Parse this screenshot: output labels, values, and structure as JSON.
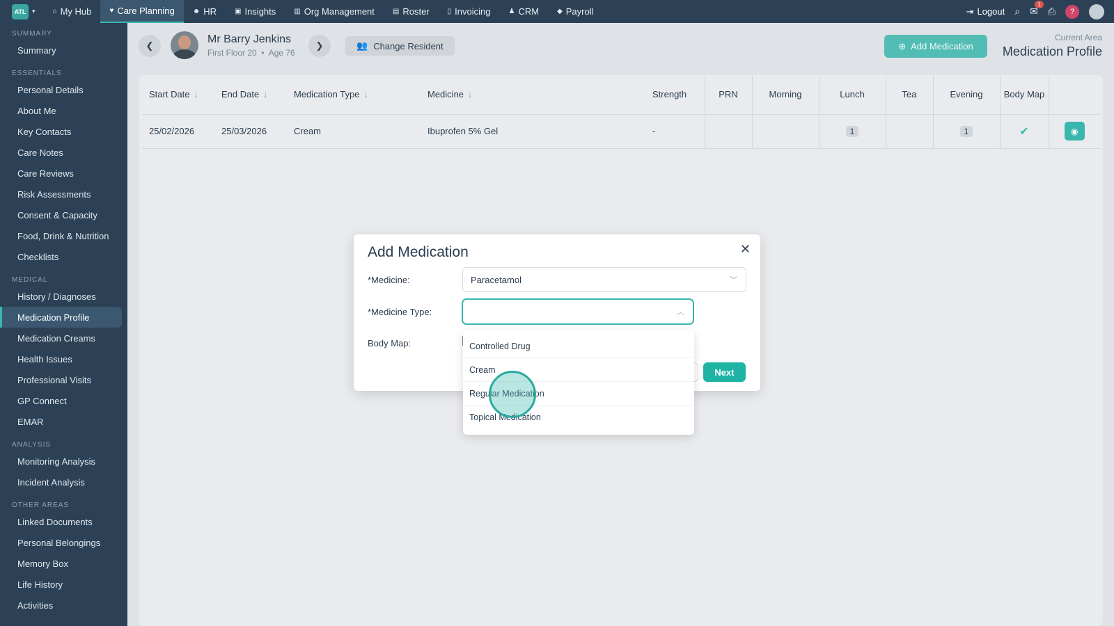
{
  "topnav": {
    "logo": "ATL",
    "items": [
      {
        "icon": "home-icon",
        "label": "My Hub"
      },
      {
        "icon": "heart-icon",
        "label": "Care Planning",
        "active": true
      },
      {
        "icon": "people-icon",
        "label": "HR"
      },
      {
        "icon": "insights-icon",
        "label": "Insights"
      },
      {
        "icon": "building-icon",
        "label": "Org Management"
      },
      {
        "icon": "calendar-icon",
        "label": "Roster"
      },
      {
        "icon": "document-icon",
        "label": "Invoicing"
      },
      {
        "icon": "user-tie-icon",
        "label": "CRM"
      },
      {
        "icon": "tag-icon",
        "label": "Payroll"
      }
    ],
    "logout": "Logout",
    "mail_badge": "1",
    "help": "?"
  },
  "sidebar": {
    "sections": [
      {
        "title": "SUMMARY",
        "items": [
          "Summary"
        ]
      },
      {
        "title": "ESSENTIALS",
        "items": [
          "Personal Details",
          "About Me",
          "Key Contacts",
          "Care Notes",
          "Care Reviews",
          "Risk Assessments",
          "Consent & Capacity",
          "Food, Drink & Nutrition",
          "Checklists"
        ]
      },
      {
        "title": "MEDICAL",
        "items": [
          "History / Diagnoses",
          "Medication Profile",
          "Medication Creams",
          "Health Issues",
          "Professional Visits",
          "GP Connect",
          "EMAR"
        ]
      },
      {
        "title": "ANALYSIS",
        "items": [
          "Monitoring Analysis",
          "Incident Analysis"
        ]
      },
      {
        "title": "OTHER AREAS",
        "items": [
          "Linked Documents",
          "Personal Belongings",
          "Memory Box",
          "Life History",
          "Activities"
        ]
      }
    ],
    "active": "Medication Profile"
  },
  "header": {
    "resident_name": "Mr Barry Jenkins",
    "resident_location": "First Floor 20",
    "resident_age": "Age 76",
    "change_resident": "Change Resident",
    "add_medication": "Add Medication",
    "current_area_label": "Current Area",
    "current_area": "Medication Profile"
  },
  "table": {
    "columns": [
      "Start Date",
      "End Date",
      "Medication Type",
      "Medicine",
      "Strength",
      "PRN",
      "Morning",
      "Lunch",
      "Tea",
      "Evening",
      "Body Map"
    ],
    "rows": [
      {
        "start": "25/02/2026",
        "end": "25/03/2026",
        "type": "Cream",
        "medicine": "Ibuprofen 5% Gel",
        "strength": "-",
        "prn": "",
        "morning": "",
        "lunch": "1",
        "tea": "",
        "evening": "1",
        "body_map": true
      }
    ]
  },
  "modal": {
    "title": "Add Medication",
    "medicine_label": "*Medicine:",
    "medicine_value": "Paracetamol",
    "type_label": "*Medicine Type:",
    "type_value": "",
    "body_map_label": "Body Map:",
    "next": "Next"
  },
  "dropdown": {
    "options": [
      "Controlled Drug",
      "Cream",
      "Regular Medication",
      "Topical Medication"
    ]
  },
  "colors": {
    "accent": "#39b7ad",
    "nav": "#2c4156",
    "danger": "#d0466a"
  }
}
